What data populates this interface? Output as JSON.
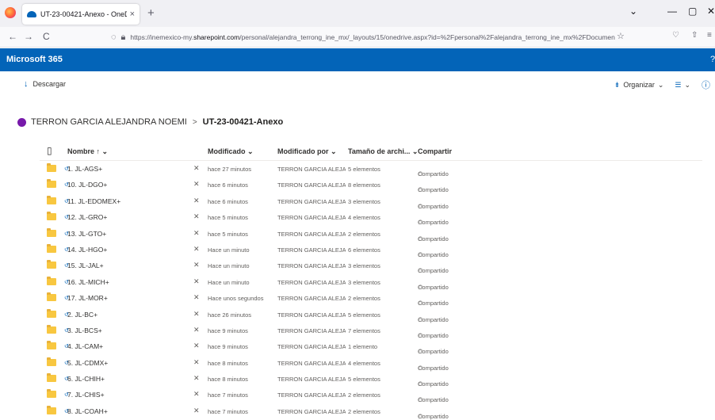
{
  "browser": {
    "tab_title": "UT-23-00421-Anexo - OneDrive",
    "tab_close": "×",
    "new_tab": "+",
    "url_prefix": "https://inemexico-my.",
    "url_domain": "sharepoint.com",
    "url_rest": "/personal/alejandra_terrong_ine_mx/_layouts/15/onedrive.aspx?id=%2Fpersonal%2Falejandra_terrong_ine_mx%2FDocumen",
    "back": "←",
    "forward": "→",
    "reload": "C",
    "minimize": "—",
    "maximize": "▢",
    "close": "✕",
    "dropdown": "⌄"
  },
  "suite": {
    "title": "Microsoft 365"
  },
  "commandbar": {
    "download_icon": "↓",
    "download_label": "Descargar",
    "organize_label": "Organizar",
    "view_icon": "☰",
    "info_icon": "ⓘ"
  },
  "breadcrumb": {
    "owner": "TERRON GARCIA ALEJANDRA NOEMI",
    "separator": ">",
    "current": "UT-23-00421-Anexo"
  },
  "list": {
    "columns": {
      "name": "Nombre ↑ ⌄",
      "modified": "Modificado ⌄",
      "modified_by": "Modificado por ⌄",
      "size": "Tamaño de archi... ⌄",
      "share": "Compartir"
    },
    "rows": [
      {
        "name": "1. JL-AGS+",
        "modified": "hace 27 minutos",
        "by": "TERRON GARCIA ALEJANI",
        "size": "5 elementos",
        "share": "Compartido"
      },
      {
        "name": "10. JL-DGO+",
        "modified": "hace 6 minutos",
        "by": "TERRON GARCIA ALEJANI",
        "size": "8 elementos",
        "share": "Compartido"
      },
      {
        "name": "11. JL-EDOMEX+",
        "modified": "hace 6 minutos",
        "by": "TERRON GARCIA ALEJANI",
        "size": "3 elementos",
        "share": "Compartido"
      },
      {
        "name": "12. JL-GRO+",
        "modified": "hace 5 minutos",
        "by": "TERRON GARCIA ALEJANI",
        "size": "4 elementos",
        "share": "Compartido"
      },
      {
        "name": "13. JL-GTO+",
        "modified": "hace 5 minutos",
        "by": "TERRON GARCIA ALEJANI",
        "size": "2 elementos",
        "share": "Compartido"
      },
      {
        "name": "14. JL-HGO+",
        "modified": "Hace un minuto",
        "by": "TERRON GARCIA ALEJANI",
        "size": "6 elementos",
        "share": "Compartido"
      },
      {
        "name": "15. JL-JAL+",
        "modified": "Hace un minuto",
        "by": "TERRON GARCIA ALEJANI",
        "size": "3 elementos",
        "share": "Compartido"
      },
      {
        "name": "16. JL-MICH+",
        "modified": "Hace un minuto",
        "by": "TERRON GARCIA ALEJANI",
        "size": "3 elementos",
        "share": "Compartido"
      },
      {
        "name": "17. JL-MOR+",
        "modified": "Hace unos segundos",
        "by": "TERRON GARCIA ALEJANI",
        "size": "2 elementos",
        "share": "Compartido"
      },
      {
        "name": "2. JL-BC+",
        "modified": "hace 26 minutos",
        "by": "TERRON GARCIA ALEJANI",
        "size": "5 elementos",
        "share": "Compartido"
      },
      {
        "name": "3. JL-BCS+",
        "modified": "hace 9 minutos",
        "by": "TERRON GARCIA ALEJANI",
        "size": "7 elementos",
        "share": "Compartido"
      },
      {
        "name": "4. JL-CAM+",
        "modified": "hace 9 minutos",
        "by": "TERRON GARCIA ALEJANI",
        "size": "1 elemento",
        "share": "Compartido"
      },
      {
        "name": "5. JL-CDMX+",
        "modified": "hace 8 minutos",
        "by": "TERRON GARCIA ALEJANI",
        "size": "4 elementos",
        "share": "Compartido"
      },
      {
        "name": "6. JL-CHIH+",
        "modified": "hace 8 minutos",
        "by": "TERRON GARCIA ALEJANI",
        "size": "5 elementos",
        "share": "Compartido"
      },
      {
        "name": "7. JL-CHIS+",
        "modified": "hace 7 minutos",
        "by": "TERRON GARCIA ALEJANI",
        "size": "2 elementos",
        "share": "Compartido"
      },
      {
        "name": "8. JL-COAH+",
        "modified": "hace 7 minutos",
        "by": "TERRON GARCIA ALEJANI",
        "size": "2 elementos",
        "share": "Compartido"
      }
    ]
  },
  "icons": {
    "pin": "✕",
    "share": "⚇",
    "sync": "↺"
  },
  "colors": {
    "suite_bar": "#0364b8",
    "folder": "#f8c740",
    "avatar": "#7719aa"
  }
}
